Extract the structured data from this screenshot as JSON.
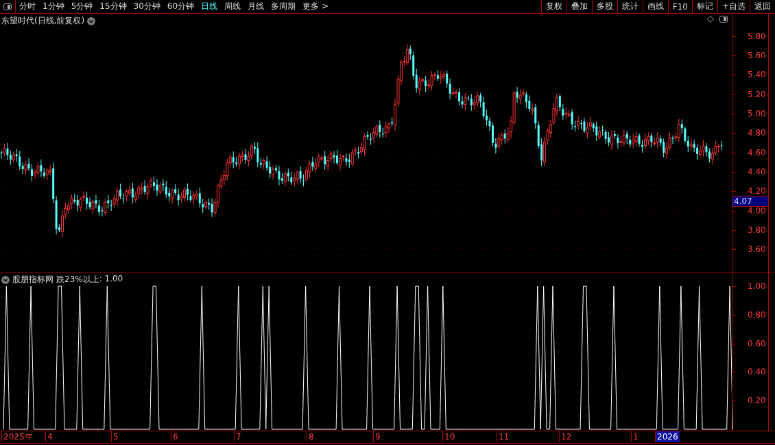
{
  "toolbar": {
    "periods": [
      {
        "label": "分时",
        "selected": false
      },
      {
        "label": "1分钟",
        "selected": false
      },
      {
        "label": "5分钟",
        "selected": false
      },
      {
        "label": "15分钟",
        "selected": false
      },
      {
        "label": "30分钟",
        "selected": false
      },
      {
        "label": "60分钟",
        "selected": false
      },
      {
        "label": "日线",
        "selected": true
      },
      {
        "label": "周线",
        "selected": false
      },
      {
        "label": "月线",
        "selected": false
      },
      {
        "label": "多周期",
        "selected": false
      },
      {
        "label": "更多 >",
        "selected": false
      }
    ],
    "buttons": [
      "复权",
      "叠加",
      "多股",
      "统计",
      "画线",
      "F10",
      "标记",
      "+自选",
      "返回"
    ]
  },
  "price_chart": {
    "title": "东望时代(日线,前复权)",
    "ticks": [
      "5.80",
      "5.60",
      "5.40",
      "5.20",
      "5.00",
      "4.80",
      "4.60",
      "4.40",
      "4.20",
      "4.00",
      "3.80",
      "3.60"
    ],
    "current_price": "4.07"
  },
  "indicator": {
    "name": "股朋指标网",
    "reading": ": 1.00",
    "chart_data": {
      "type": "line",
      "ylim": [
        0,
        1
      ],
      "yticks": [
        {
          "value": 1,
          "label": "1.00"
        },
        {
          "value": 0.8,
          "label": "0.80"
        },
        {
          "value": 0.6,
          "label": "0.60"
        },
        {
          "value": 0.4,
          "label": "0.40"
        },
        {
          "value": 0.2,
          "label": "0.20"
        }
      ],
      "series": [
        {
          "name": "跌23%以上",
          "color": "#ffffff",
          "values": [
            0,
            1,
            0,
            0,
            0,
            0,
            0,
            0,
            0,
            1,
            0,
            0,
            0,
            0,
            0,
            0,
            0,
            0,
            1,
            1,
            0,
            0,
            0,
            0,
            0,
            1,
            0,
            0,
            0,
            0,
            0,
            0,
            0,
            0,
            1,
            0,
            0,
            0,
            0,
            0,
            0,
            0,
            0,
            0,
            0,
            0,
            0,
            0,
            0,
            1,
            1,
            0,
            0,
            0,
            0,
            0,
            0,
            0,
            0,
            0,
            0,
            0,
            0,
            0,
            0,
            1,
            0,
            0,
            0,
            0,
            0,
            0,
            0,
            0,
            0,
            0,
            0,
            1,
            0,
            0,
            0,
            0,
            0,
            0,
            0,
            1,
            0,
            1,
            0,
            0,
            0,
            0,
            0,
            0,
            0,
            0,
            0,
            0,
            0,
            1,
            0,
            0,
            0,
            0,
            0,
            0,
            0,
            0,
            0,
            0,
            1,
            0,
            0,
            0,
            0,
            0,
            0,
            0,
            0,
            0,
            1,
            0,
            0,
            0,
            0,
            0,
            0,
            0,
            0,
            1,
            0,
            0,
            0,
            0,
            0,
            1,
            1,
            0,
            0,
            1,
            0,
            0,
            0,
            0,
            1,
            0,
            0,
            0,
            0,
            0,
            0,
            0,
            0,
            0,
            0,
            0,
            0,
            0,
            0,
            0,
            0,
            0,
            0,
            0,
            0,
            0,
            0,
            0,
            0,
            0,
            0,
            0,
            0,
            0,
            0,
            1,
            0,
            1,
            0,
            0,
            1,
            0,
            0,
            0,
            0,
            0,
            0,
            0,
            0,
            0,
            1,
            1,
            0,
            0,
            0,
            0,
            0,
            0,
            0,
            0,
            1,
            0,
            0,
            0,
            0,
            0,
            0,
            0,
            0,
            0,
            0,
            0,
            0,
            0,
            0,
            1,
            0,
            0,
            0,
            0,
            0,
            0,
            1,
            0,
            0,
            0,
            0,
            0,
            1,
            0,
            0,
            0,
            0,
            0,
            0,
            0,
            0,
            0,
            1,
            0
          ]
        }
      ]
    }
  },
  "date_axis": [
    {
      "label": "2025年",
      "highlighted": false
    },
    {
      "label": "4",
      "highlighted": false
    },
    {
      "label": "5",
      "highlighted": false
    },
    {
      "label": "6",
      "highlighted": false
    },
    {
      "label": "7",
      "highlighted": false
    },
    {
      "label": "8",
      "highlighted": false
    },
    {
      "label": "9",
      "highlighted": false
    },
    {
      "label": "10",
      "highlighted": false
    },
    {
      "label": "11",
      "highlighted": false
    },
    {
      "label": "12",
      "highlighted": false
    },
    {
      "label": "1",
      "highlighted": false
    },
    {
      "label": "2026",
      "highlighted": true
    }
  ]
}
